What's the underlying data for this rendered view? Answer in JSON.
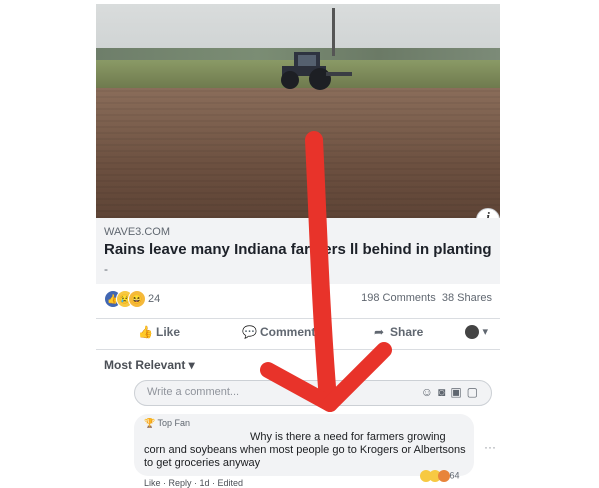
{
  "post": {
    "source": "WAVE3.COM",
    "headline": "Rains leave many Indiana farmers ll behind in planting",
    "dash": "-",
    "info": "i",
    "reaction_count": "24",
    "comments_count": "198 Comments",
    "shares_count": "38 Shares"
  },
  "actions": {
    "like": "Like",
    "comment": "Comment",
    "share": "Share"
  },
  "sort": {
    "label": "Most Relevant ▾"
  },
  "composer": {
    "placeholder": "Write a comment..."
  },
  "comment": {
    "badge": "Top Fan",
    "text": "Why is there a need for farmers growing corn and soybeans when most people go to Krogers or Albertsons to get groceries anyway",
    "reaction_count": "64",
    "meta": "Like · Reply · 1d · Edited",
    "more": "···"
  },
  "colors": {
    "arrow": "#e8332a",
    "like_blue": "#4267b2"
  }
}
